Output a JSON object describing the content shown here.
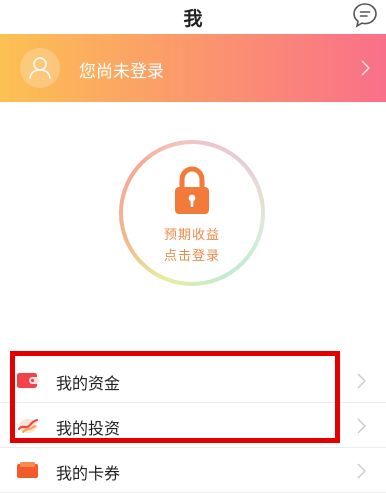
{
  "header": {
    "title": "我"
  },
  "banner": {
    "login_text": "您尚未登录",
    "gradient_start": "#fcc153",
    "gradient_end": "#f9708a"
  },
  "login_prompt": {
    "line1": "预期收益",
    "line2": "点击登录",
    "accent": "#f08a4a"
  },
  "menu": {
    "items": [
      {
        "label": "我的资金",
        "icon": "wallet-icon"
      },
      {
        "label": "我的投资",
        "icon": "investment-icon"
      },
      {
        "label": "我的卡券",
        "icon": "coupon-icon"
      }
    ]
  },
  "annotation": {
    "highlight_color": "#e40000"
  }
}
